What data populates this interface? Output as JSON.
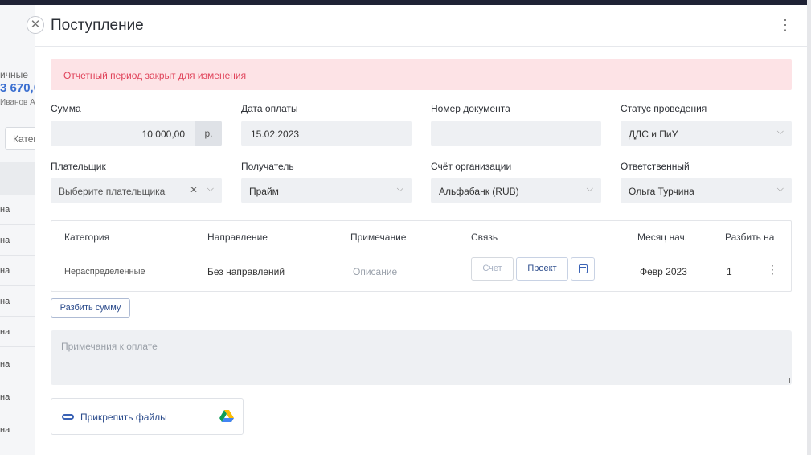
{
  "background": {
    "label": "ичные",
    "amount": "3 670,0",
    "person": "Иванов А.",
    "search_text": "Катег",
    "rows": [
      "на",
      "на",
      "на",
      "на",
      "на",
      "на",
      "на",
      "на"
    ]
  },
  "modal": {
    "title": "Поступление",
    "alert": "Отчетный период закрыт для изменения",
    "sum": {
      "label": "Сумма",
      "value": "10 000,00",
      "currency": "р."
    },
    "date": {
      "label": "Дата оплаты",
      "value": "15.02.2023"
    },
    "doc_number": {
      "label": "Номер документа",
      "value": ""
    },
    "status": {
      "label": "Статус проведения",
      "value": "ДДС и ПиУ"
    },
    "payer": {
      "label": "Плательщик",
      "value": "Выберите плательщика"
    },
    "recipient": {
      "label": "Получатель",
      "value": "Прайм"
    },
    "account": {
      "label": "Счёт организации",
      "value": "Альфабанк (RUB)"
    },
    "responsible": {
      "label": "Ответственный",
      "value": "Ольга Турчина"
    },
    "table": {
      "headers": [
        "Категория",
        "Направление",
        "Примечание",
        "Связь",
        "Месяц нач.",
        "Разбить на"
      ],
      "row": {
        "category": "Нераспределенные",
        "direction": "Без направлений",
        "note": "Описание",
        "link_invoice": "Счет",
        "link_project": "Проект",
        "month": "Февр 2023",
        "split": "1"
      }
    },
    "split_button": "Разбить сумму",
    "notes_placeholder": "Примечания к оплате",
    "attach_label": "Прикрепить файлы"
  },
  "icons": {
    "close": "close-icon",
    "more": "more-vertical-icon",
    "chevron": "chevron-down-icon",
    "calendar": "calendar-icon",
    "clip": "paperclip-icon",
    "drive": "google-drive-icon"
  },
  "colors": {
    "accent": "#3a62b5",
    "alert_bg": "#fde3e6",
    "alert_text": "#e0435a",
    "field_bg": "#eef0f3"
  }
}
